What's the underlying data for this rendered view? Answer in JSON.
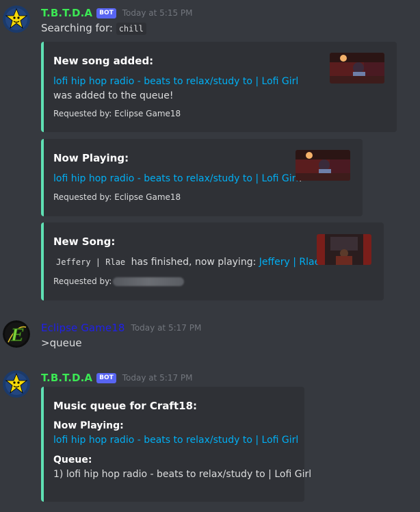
{
  "messages": [
    {
      "author": "T.B.T.D.A",
      "bot_tag": "BOT",
      "timestamp": "Today at 5:15 PM",
      "text_prefix": "Searching for:",
      "query": "chill",
      "embeds": [
        {
          "title": "New song added:",
          "link": "lofi hip hop radio - beats to relax/study to | Lofi Girl",
          "suffix": "was added to the queue!",
          "footer": "Requested by: Eclipse Game18"
        },
        {
          "title": "Now Playing:",
          "link": "lofi hip hop radio - beats to relax/study to | Lofi Girl",
          "suffix": "!",
          "footer": "Requested by: Eclipse Game18"
        },
        {
          "title": "New Song:",
          "code": "Jeffery | Rlae",
          "middle": "has finished, now playing:",
          "link": "Jeffery | Rlae",
          "suffix": "!",
          "footer": "Requested by:"
        }
      ]
    },
    {
      "author": "Eclipse Game18",
      "timestamp": "Today at 5:17 PM",
      "text": ">queue"
    },
    {
      "author": "T.B.T.D.A",
      "bot_tag": "BOT",
      "timestamp": "Today at 5:17 PM",
      "embed": {
        "title": "Music queue for Craft18:",
        "now_playing_label": "Now Playing:",
        "now_playing_link": "lofi hip hop radio - beats to relax/study to | Lofi Girl",
        "queue_label": "Queue:",
        "queue_item": "1) lofi hip hop radio - beats to relax/study to | Lofi Girl"
      }
    }
  ],
  "colors": {
    "background": "#36393f",
    "embed_background": "#2f3136",
    "embed_accent": "#5fe0b3",
    "bot_name": "#3ce854",
    "user_name": "#1f20e8",
    "link": "#00aff4",
    "bot_tag": "#5865f2"
  },
  "icons": {
    "bot_avatar": "star-badge-icon",
    "user_avatar": "green-e-icon"
  }
}
